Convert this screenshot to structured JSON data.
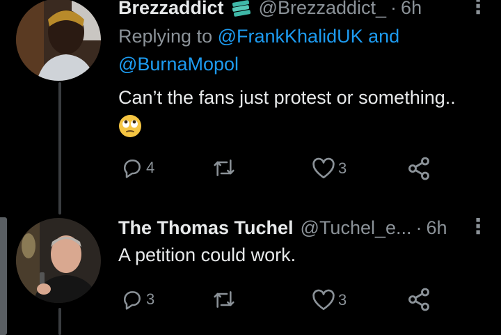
{
  "tweets": [
    {
      "name": "Brezzaddict",
      "handle": "@Brezzaddict_",
      "time": "6h",
      "replying_prefix": "Replying to",
      "replying_to_1": "@FrankKhalidUK",
      "replying_and": "and",
      "replying_to_2": "@BurnaMopol",
      "text": "Can’t the fans just protest or something..",
      "emoji": "face-with-rolling-eyes",
      "replies": "4",
      "retweets": "",
      "likes": "3"
    },
    {
      "name": "The Thomas Tuchel",
      "handle": "@Tuchel_e...",
      "time": "6h",
      "text": "A petition could work.",
      "replies": "3",
      "retweets": "",
      "likes": "3"
    }
  ],
  "colors": {
    "background": "#000000",
    "text": "#e7e9ea",
    "muted": "#8b9298",
    "link": "#1d9bf0",
    "emoji": "#f5c542"
  }
}
